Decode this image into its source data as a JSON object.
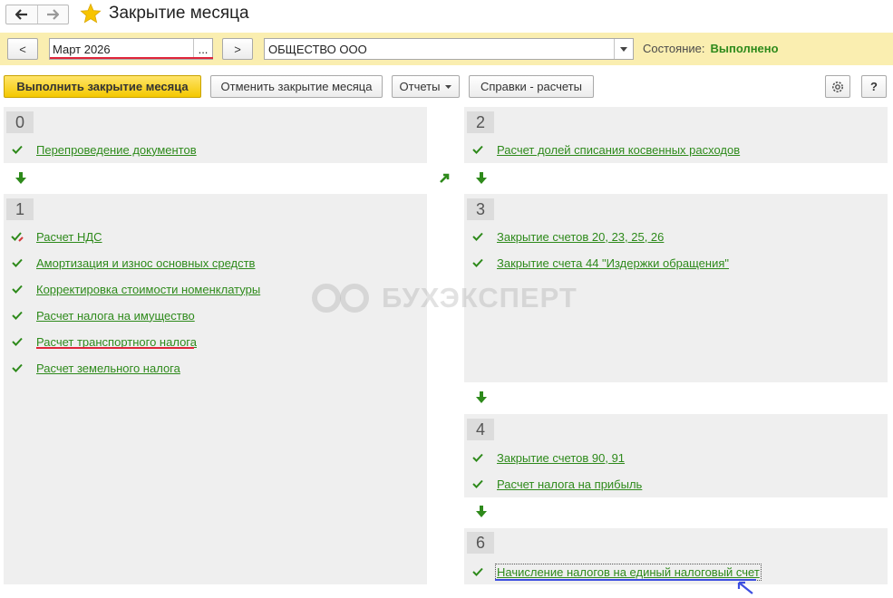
{
  "window": {
    "title": "Закрытие месяца"
  },
  "toolbar": {
    "prev_label": "<",
    "period_value": "Март 2026",
    "period_more": "...",
    "next_label": ">",
    "org_value": "ОБЩЕСТВО ООО",
    "state_label": "Состояние:",
    "state_value": "Выполнено"
  },
  "actions": {
    "run_label": "Выполнить закрытие месяца",
    "cancel_label": "Отменить закрытие месяца",
    "reports_label": "Отчеты",
    "calcs_label": "Справки - расчеты",
    "help_label": "?"
  },
  "groups": {
    "g0": {
      "number": "0",
      "items": [
        "Перепроведение документов"
      ]
    },
    "g1": {
      "number": "1",
      "items": [
        "Расчет НДС",
        "Амортизация и износ основных средств",
        "Корректировка стоимости номенклатуры",
        "Расчет налога на имущество",
        "Расчет транспортного налога",
        "Расчет земельного налога"
      ]
    },
    "g2": {
      "number": "2",
      "items": [
        "Расчет долей списания косвенных расходов"
      ]
    },
    "g3": {
      "number": "3",
      "items": [
        "Закрытие счетов 20, 23, 25, 26",
        "Закрытие счета 44 \"Издержки обращения\""
      ]
    },
    "g4": {
      "number": "4",
      "items": [
        "Закрытие счетов 90, 91",
        "Расчет налога на прибыль"
      ]
    },
    "g6": {
      "number": "6",
      "items": [
        "Начисление налогов на единый налоговый счет"
      ]
    }
  },
  "watermark": {
    "text": "БУХЭКСПЕРТ"
  },
  "colors": {
    "accent_green": "#2e8a1b",
    "panel_yellow": "#faeeb0",
    "primary_yellow": "#f4c800",
    "underline_red": "#e0253a",
    "underline_blue": "#3c4ee0"
  }
}
